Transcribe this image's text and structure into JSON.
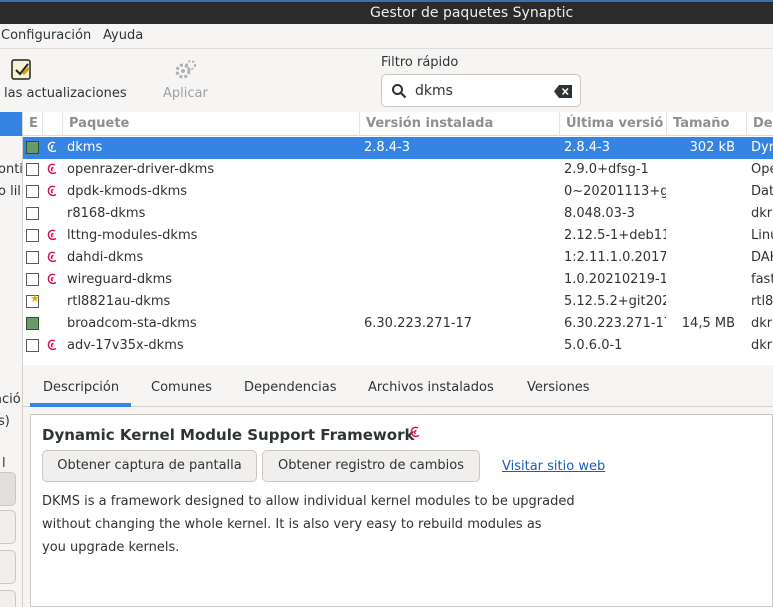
{
  "window": {
    "title": "Gestor de paquetes Synaptic"
  },
  "menu": {
    "items": [
      {
        "label": "Configuración"
      },
      {
        "label": "Ayuda"
      }
    ]
  },
  "toolbar": {
    "updates_label": "las actualizaciones",
    "apply_label": "Aplicar",
    "filter_label": "Filtro rápido",
    "search_value": "dkms"
  },
  "sidebar": {
    "fragments": [
      "onti",
      "o lil",
      "ació",
      "s)",
      "l"
    ]
  },
  "columns": {
    "status": "E",
    "package": "Paquete",
    "installed": "Versión instalada",
    "latest": "Última versió",
    "size": "Tamaño",
    "description": "De"
  },
  "packages": [
    {
      "name": "dkms",
      "installed": "2.8.4-3",
      "latest": "2.8.4-3",
      "size": "302 kB",
      "desc": "Dyn",
      "state": "installed",
      "debian": true
    },
    {
      "name": "openrazer-driver-dkms",
      "installed": "",
      "latest": "2.9.0+dfsg-1",
      "size": "",
      "desc": "Ope",
      "state": "none",
      "debian": true
    },
    {
      "name": "dpdk-kmods-dkms",
      "installed": "",
      "latest": "0~20201113+g",
      "size": "",
      "desc": "Dat",
      "state": "none",
      "debian": true
    },
    {
      "name": "r8168-dkms",
      "installed": "",
      "latest": "8.048.03-3",
      "size": "",
      "desc": "dkr",
      "state": "none",
      "debian": false
    },
    {
      "name": "lttng-modules-dkms",
      "installed": "",
      "latest": "2.12.5-1+deb11",
      "size": "",
      "desc": "Linu",
      "state": "none",
      "debian": true
    },
    {
      "name": "dahdi-dkms",
      "installed": "",
      "latest": "1:2.11.1.0.2017",
      "size": "",
      "desc": "DAH",
      "state": "none",
      "debian": true
    },
    {
      "name": "wireguard-dkms",
      "installed": "",
      "latest": "1.0.20210219-1",
      "size": "",
      "desc": "fast",
      "state": "none",
      "debian": true
    },
    {
      "name": "rtl8821au-dkms",
      "installed": "",
      "latest": "5.12.5.2+git202",
      "size": "",
      "desc": "rtl8",
      "state": "new",
      "debian": false
    },
    {
      "name": "broadcom-sta-dkms",
      "installed": "6.30.223.271-17",
      "latest": "6.30.223.271-17",
      "size": "14,5 MB",
      "desc": "dkr",
      "state": "installed",
      "debian": false
    },
    {
      "name": "adv-17v35x-dkms",
      "installed": "",
      "latest": "5.0.6.0-1",
      "size": "",
      "desc": "dkr",
      "state": "none",
      "debian": true
    }
  ],
  "tabs": [
    {
      "label": "Descripción"
    },
    {
      "label": "Comunes"
    },
    {
      "label": "Dependencias"
    },
    {
      "label": "Archivos instalados"
    },
    {
      "label": "Versiones"
    }
  ],
  "details": {
    "title": "Dynamic Kernel Module Support Framework",
    "screenshot_button": "Obtener captura de pantalla",
    "changelog_button": "Obtener registro de cambios",
    "website_link": "Visitar sitio web",
    "description_lines": [
      "DKMS is a framework designed to allow individual kernel modules to be upgraded",
      "without changing the whole kernel. It is also very easy to rebuild modules as",
      "you upgrade kernels."
    ]
  },
  "colors": {
    "accent": "#3584e4",
    "link": "#1a5fb4",
    "debian": "#d70a53"
  }
}
